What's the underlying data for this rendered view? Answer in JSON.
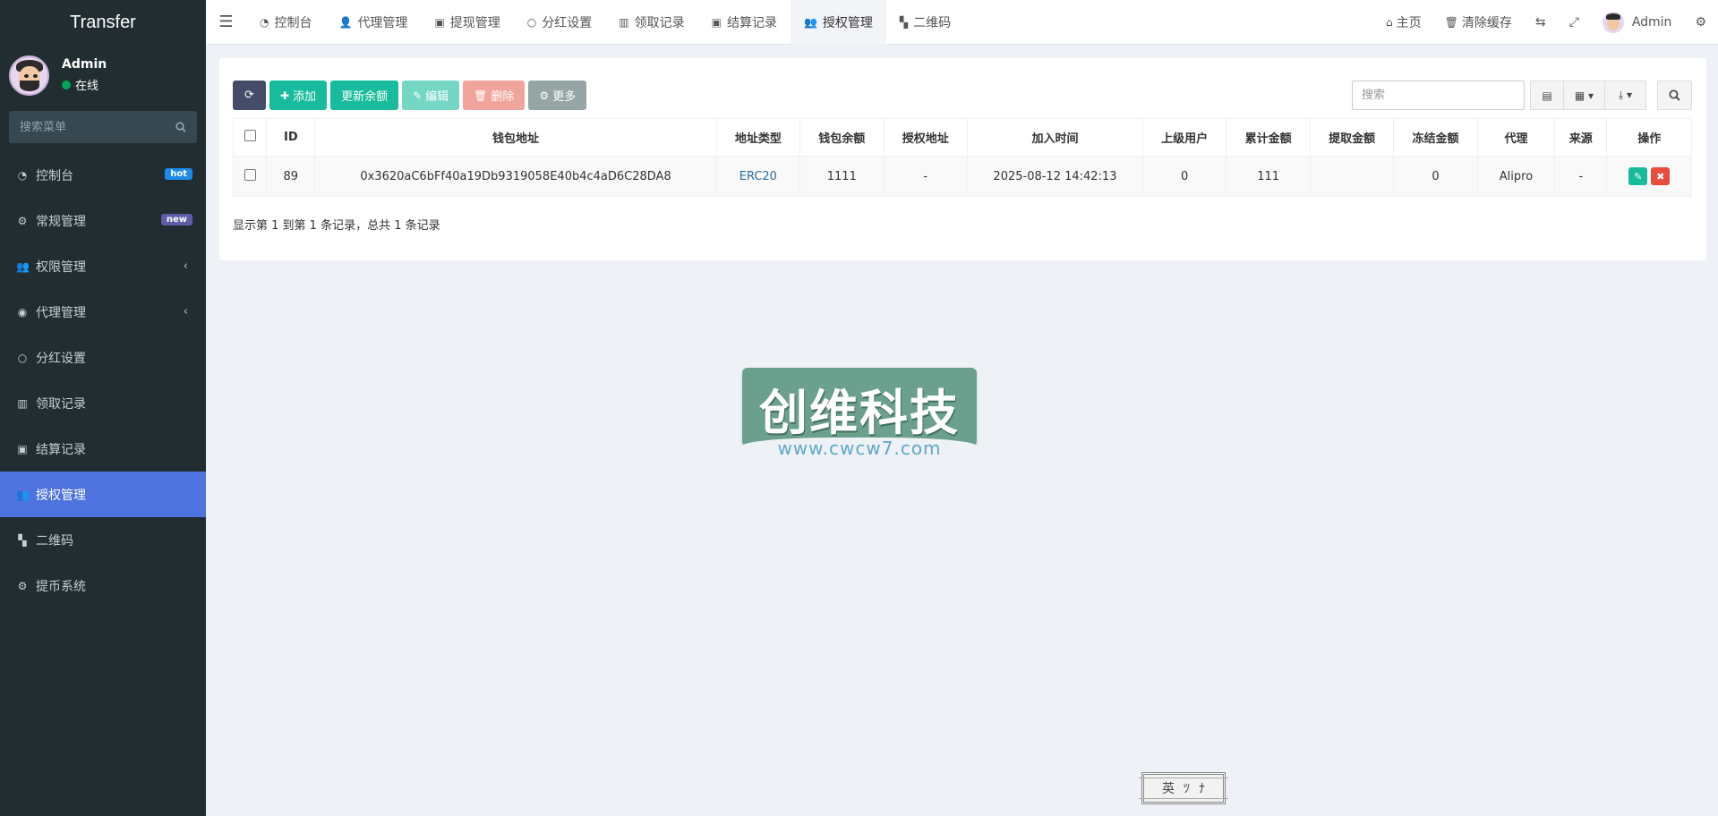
{
  "brand": "Transfer",
  "user": {
    "name": "Admin",
    "status": "在线"
  },
  "sidebar_search_placeholder": "搜索菜单",
  "menu": [
    {
      "label": "控制台",
      "icon": "dashboard-icon",
      "badge": "hot"
    },
    {
      "label": "常规管理",
      "icon": "cogs-icon",
      "badge": "new"
    },
    {
      "label": "权限管理",
      "icon": "users-icon",
      "caret": "‹"
    },
    {
      "label": "代理管理",
      "icon": "user-circle-icon",
      "caret": "‹"
    },
    {
      "label": "分红设置",
      "icon": "circle-icon"
    },
    {
      "label": "领取记录",
      "icon": "bar-icon"
    },
    {
      "label": "结算记录",
      "icon": "cc-icon"
    },
    {
      "label": "授权管理",
      "icon": "users-icon",
      "active": true
    },
    {
      "label": "二维码",
      "icon": "qrcode-icon"
    },
    {
      "label": "提币系统",
      "icon": "gear-icon"
    }
  ],
  "tabs": [
    {
      "label": "控制台",
      "icon": "dashboard-icon"
    },
    {
      "label": "代理管理",
      "icon": "user-icon"
    },
    {
      "label": "提现管理",
      "icon": "cc-icon"
    },
    {
      "label": "分红设置",
      "icon": "circle-icon"
    },
    {
      "label": "领取记录",
      "icon": "bar-icon"
    },
    {
      "label": "结算记录",
      "icon": "cc-icon"
    },
    {
      "label": "授权管理",
      "icon": "users-icon",
      "active": true
    },
    {
      "label": "二维码",
      "icon": "qrcode-icon"
    }
  ],
  "header_right": {
    "home": "主页",
    "clear_cache": "清除缓存",
    "admin": "Admin"
  },
  "toolbar": {
    "add": "添加",
    "update_balance": "更新余额",
    "edit": "编辑",
    "delete": "删除",
    "more": "更多"
  },
  "table_search_placeholder": "搜索",
  "table": {
    "columns": [
      "ID",
      "钱包地址",
      "地址类型",
      "钱包余额",
      "授权地址",
      "加入时间",
      "上级用户",
      "累计金额",
      "提取金额",
      "冻结金额",
      "代理",
      "来源",
      "操作"
    ],
    "rows": [
      [
        "89",
        "0x3620aC6bFf40a19Db9319058E40b4c4aD6C28DA8",
        "ERC20",
        "1111",
        "-",
        "2025-08-12 14:42:13",
        "0",
        "111",
        "",
        "0",
        "Alipro",
        "-"
      ]
    ]
  },
  "pager": "显示第 1 到第 1 条记录，总共 1 条记录",
  "watermark": {
    "title": "创维科技",
    "url": "www.cwcw7.com"
  },
  "ime": [
    "英",
    "ﾂ",
    "ﾅ"
  ],
  "colors": {
    "sidebar": "#222d32",
    "active": "#4e73df",
    "green": "#18bc9c",
    "red": "#e74c3c"
  }
}
